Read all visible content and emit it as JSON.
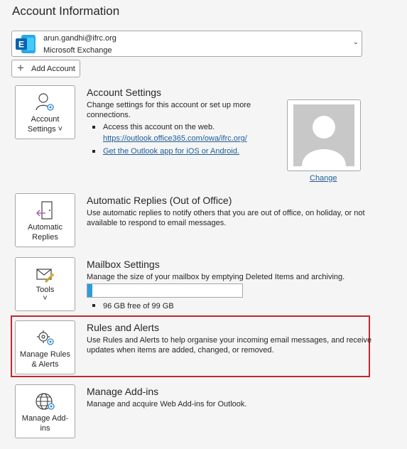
{
  "page": {
    "title": "Account Information"
  },
  "account": {
    "email": "arun.gandhi@ifrc.org",
    "type": "Microsoft Exchange",
    "add_label": "Add Account"
  },
  "account_settings": {
    "tile_label_line1": "Account",
    "tile_label_line2": "Settings ˅",
    "title": "Account Settings",
    "desc_line1": "Change settings for this account or set up more",
    "desc_line2": "connections.",
    "bullet1": "Access this account on the web.",
    "web_link": "https://outlook.office365.com/owa/ifrc.org/",
    "app_link": "Get the Outlook app for iOS or Android.",
    "change_link": "Change"
  },
  "automatic_replies": {
    "tile_label_line1": "Automatic",
    "tile_label_line2": "Replies",
    "title": "Automatic Replies (Out of Office)",
    "desc_line1": "Use automatic replies to notify others that you are out of office, on holiday, or not",
    "desc_line2": "available to respond to email messages."
  },
  "mailbox_settings": {
    "tile_label": "Tools",
    "tile_chevron": "˅",
    "title": "Mailbox Settings",
    "desc": "Manage the size of your mailbox by emptying Deleted Items and archiving.",
    "usage_fraction": 0.03,
    "free_text": "96 GB free of 99 GB"
  },
  "rules_alerts": {
    "tile_label_line1": "Manage Rules",
    "tile_label_line2": "& Alerts",
    "title": "Rules and Alerts",
    "desc_line1": "Use Rules and Alerts to help organise your incoming email messages, and receive",
    "desc_line2": "updates when items are added, changed, or removed."
  },
  "addins": {
    "tile_label_line1": "Manage Add-",
    "tile_label_line2": "ins",
    "title": "Manage Add-ins",
    "desc": "Manage and acquire Web Add-ins for Outlook."
  },
  "colors": {
    "accent_link": "#1f5d97",
    "progress": "#2d9cdb",
    "highlight": "#c4262e",
    "exchange_blue": "#0a64ad"
  }
}
